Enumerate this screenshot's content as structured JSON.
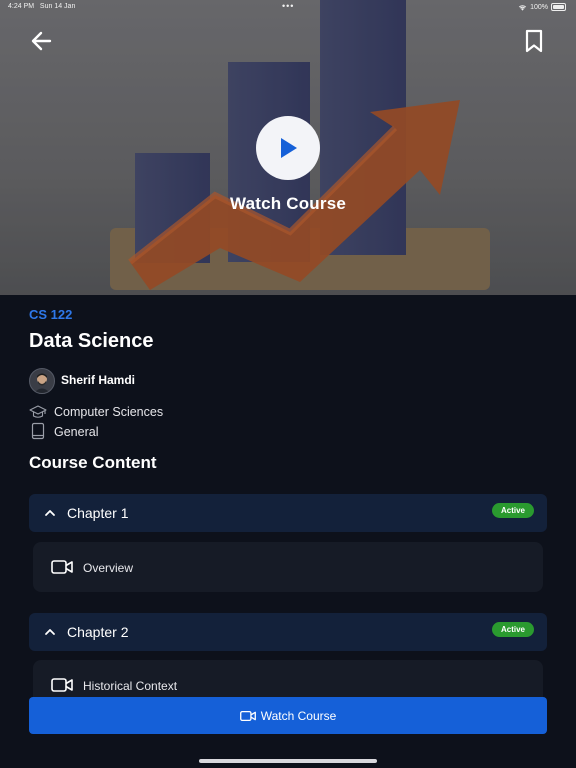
{
  "status_bar": {
    "time": "4:24 PM",
    "date": "Sun 14 Jan",
    "battery": "100%"
  },
  "hero": {
    "watch_label": "Watch Course"
  },
  "course": {
    "code": "CS 122",
    "title": "Data Science",
    "instructor": "Sherif Hamdi",
    "department": "Computer Sciences",
    "category": "General"
  },
  "content": {
    "heading": "Course Content",
    "chapters": [
      {
        "title": "Chapter 1",
        "badge": "Active",
        "lessons": [
          {
            "label": "Overview"
          }
        ]
      },
      {
        "title": "Chapter 2",
        "badge": "Active",
        "lessons": [
          {
            "label": "Historical Context"
          }
        ]
      }
    ]
  },
  "cta": {
    "label": "Watch Course"
  },
  "colors": {
    "accent": "#1560d8",
    "code_blue": "#2e78ea",
    "active_badge": "#2a9a2f",
    "chapter_bg": "#13213a",
    "background": "#0d111b"
  }
}
